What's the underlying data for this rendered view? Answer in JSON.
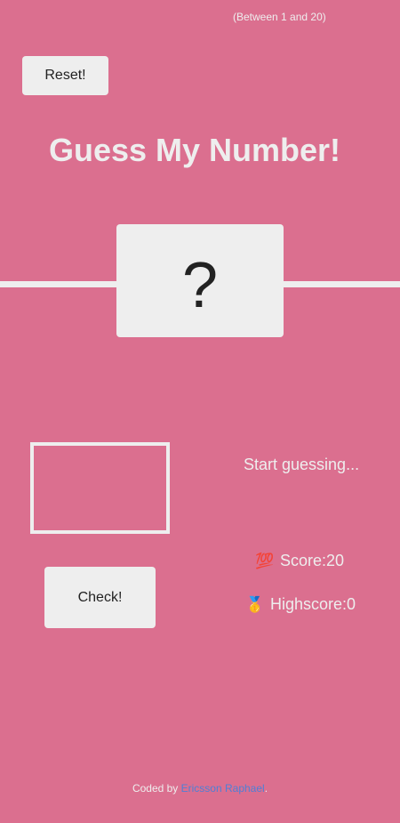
{
  "header": {
    "range_hint": "(Between 1 and 20)",
    "reset_label": "Reset!",
    "title": "Guess My Number!"
  },
  "board": {
    "secret_display": "?"
  },
  "controls": {
    "guess_value": "",
    "check_label": "Check!"
  },
  "status": {
    "message": "Start guessing...",
    "score_icon": "💯",
    "score_label": "Score: ",
    "score_value": "20",
    "highscore_icon": "🥇",
    "highscore_label": "Highscore: ",
    "highscore_value": "0"
  },
  "footer": {
    "prefix": "Coded by ",
    "author": "Ericsson Raphael",
    "suffix": "."
  },
  "colors": {
    "background": "#db6f8f",
    "panel": "#eeeeee",
    "link": "#4f7fd6"
  }
}
